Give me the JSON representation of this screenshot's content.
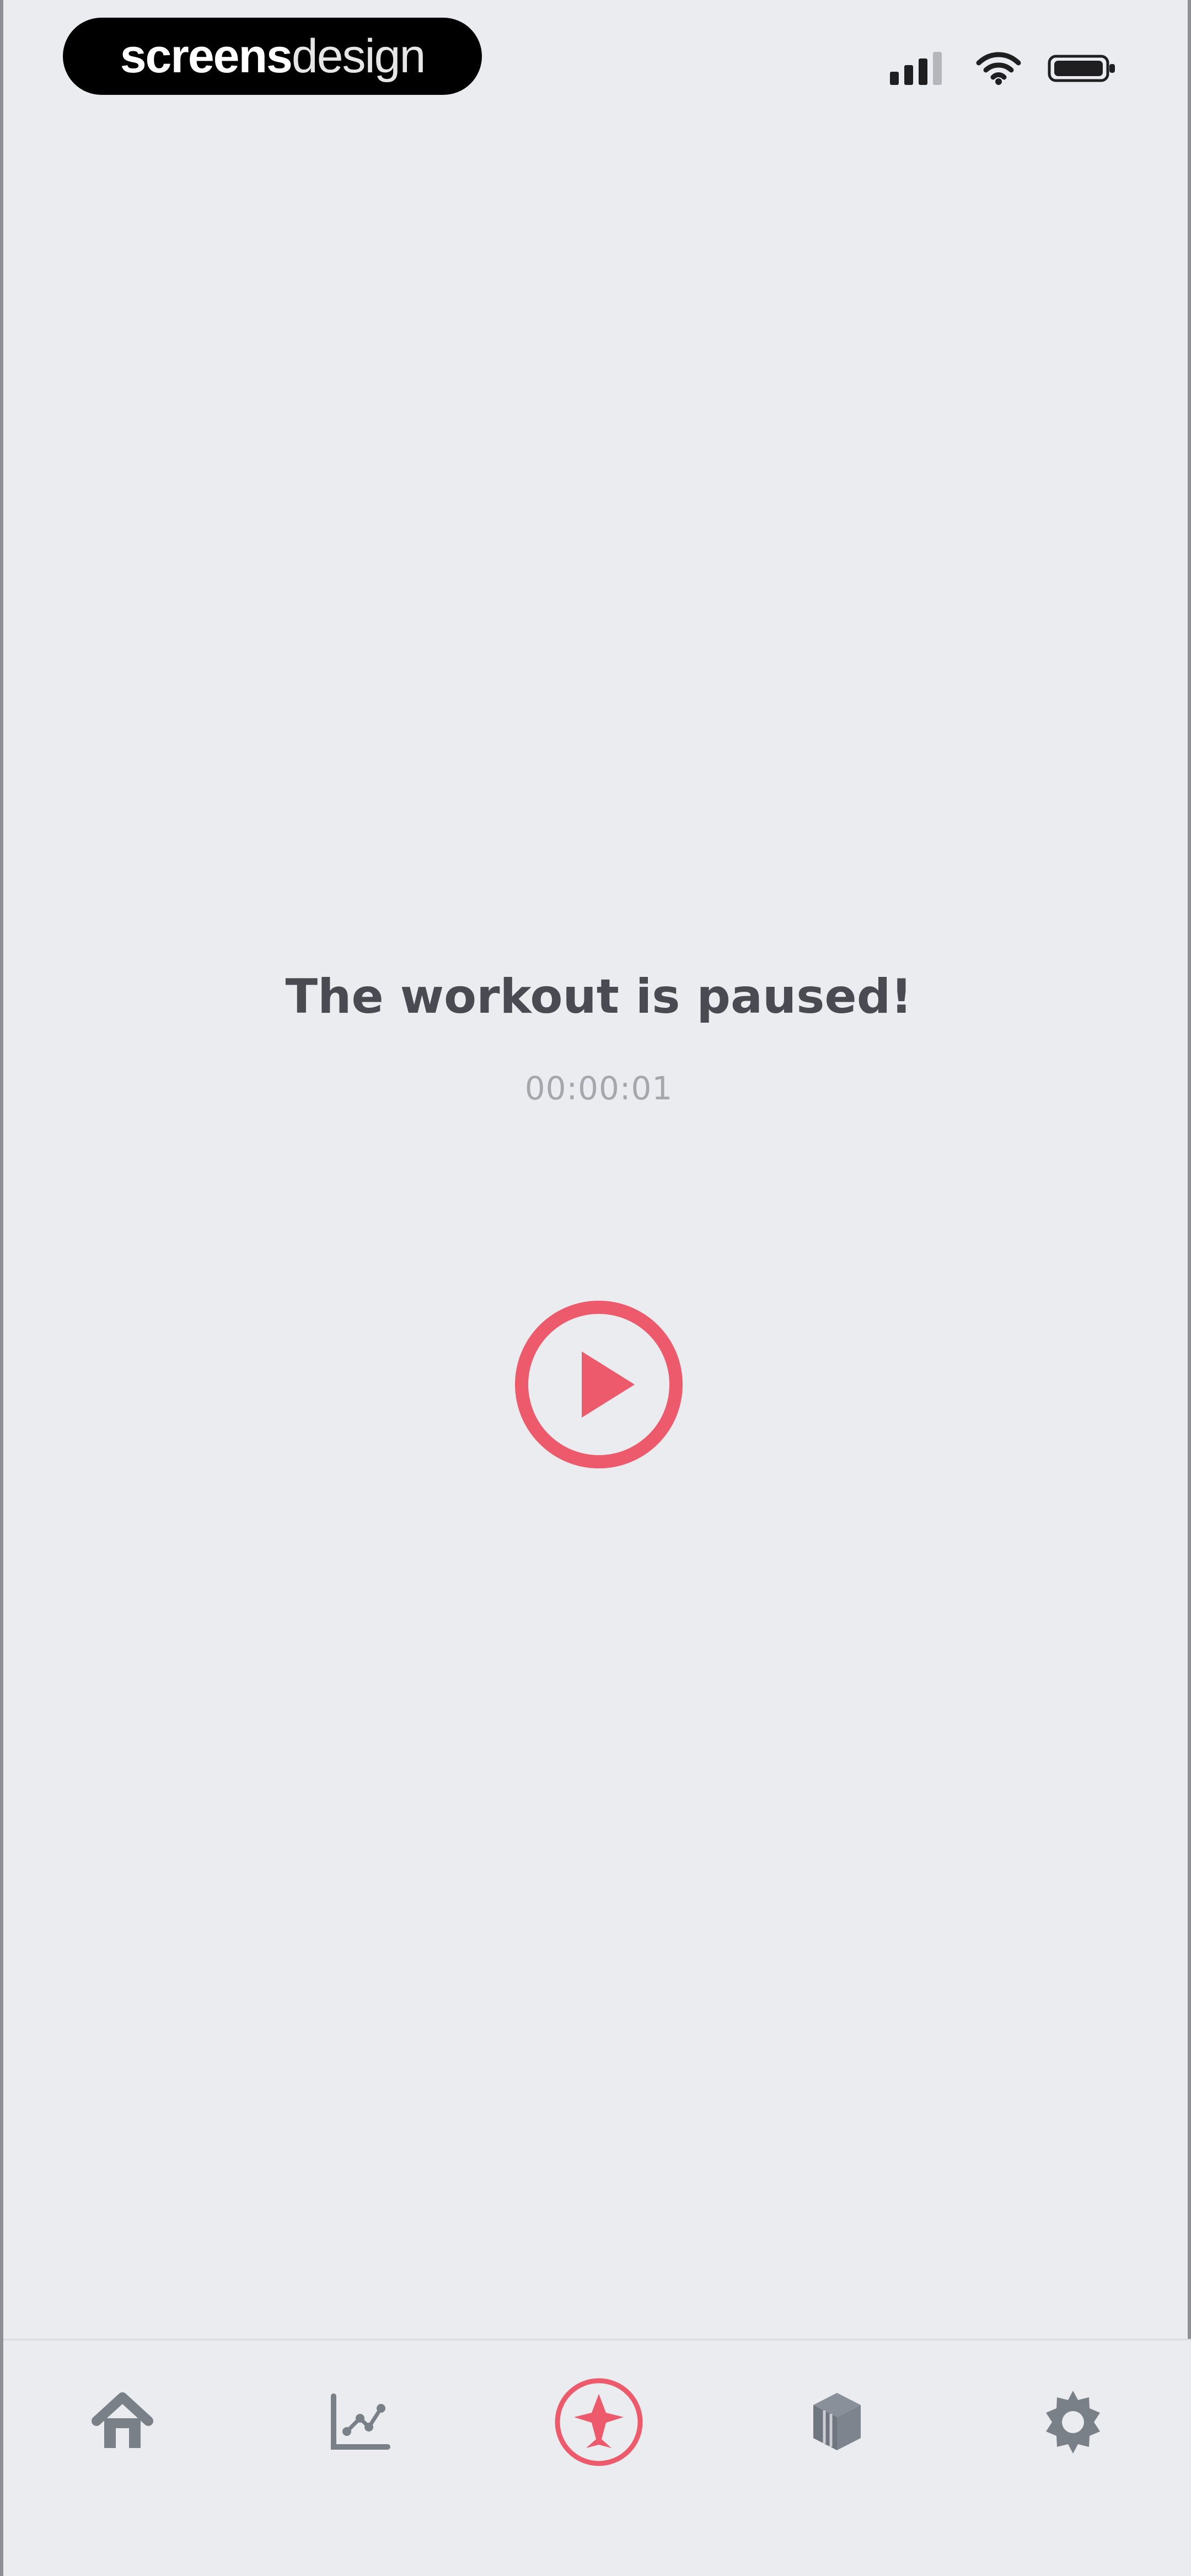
{
  "status_bar": {
    "brand_primary": "screens",
    "brand_secondary": "design",
    "icons": [
      "signal-icon",
      "wifi-icon",
      "battery-icon"
    ]
  },
  "workout_state": {
    "title": "The workout is paused!",
    "elapsed_time": "00:00:01",
    "resume_icon": "play-circle-icon"
  },
  "bottom_nav": {
    "items": [
      {
        "icon": "home-icon",
        "active": false
      },
      {
        "icon": "stats-icon",
        "active": false
      },
      {
        "icon": "workout-icon",
        "active": true
      },
      {
        "icon": "cube-icon",
        "active": false
      },
      {
        "icon": "settings-icon",
        "active": false
      }
    ]
  },
  "colors": {
    "background": "#ebecf0",
    "accent": "#ec5a6b",
    "text": "#4a4a52",
    "muted_text": "#a5a7ad",
    "nav_icon": "#7a8088"
  }
}
